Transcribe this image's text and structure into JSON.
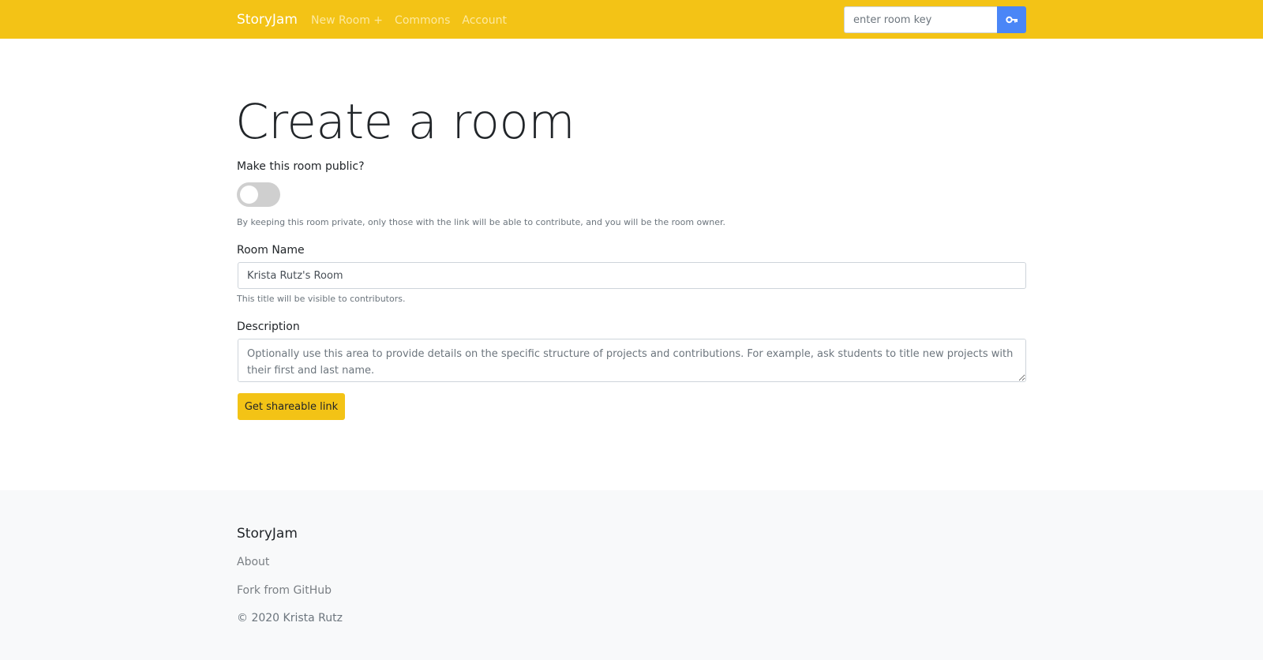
{
  "theme": {
    "brand_color": "#f3c316",
    "key_button_color": "#4a86f7",
    "footer_background": "#f8f9fa"
  },
  "navbar": {
    "brand": "StoryJam",
    "links": [
      {
        "label": "New Room +"
      },
      {
        "label": "Commons"
      },
      {
        "label": "Account"
      }
    ],
    "room_key": {
      "placeholder": "enter room key",
      "value": "",
      "button_icon": "key-icon"
    }
  },
  "form": {
    "title": "Create a room",
    "public_toggle": {
      "label": "Make this room public?",
      "checked": false,
      "help": "By keeping this room private, only those with the link will be able to contribute, and you will be the room owner."
    },
    "room_name": {
      "label": "Room Name",
      "value": "Krista Rutz's Room",
      "help": "This title will be visible to contributors."
    },
    "description": {
      "label": "Description",
      "value": "",
      "placeholder": "Optionally use this area to provide details on the specific structure of projects and contributions. For example, ask students to title new projects with their first and last name."
    },
    "submit_label": "Get shareable link"
  },
  "footer": {
    "brand": "StoryJam",
    "links": [
      {
        "label": "About"
      },
      {
        "label": "Fork from GitHub"
      }
    ],
    "copyright": "© 2020 Krista Rutz"
  }
}
